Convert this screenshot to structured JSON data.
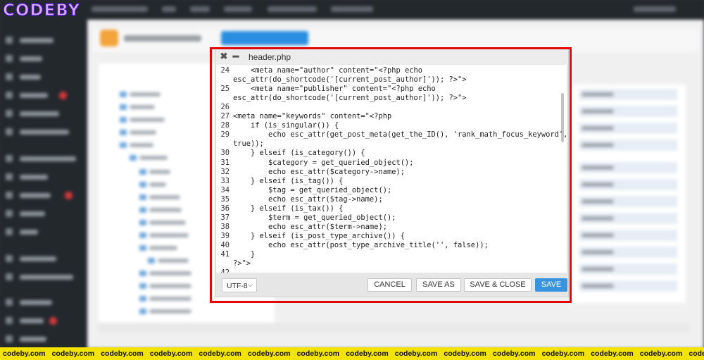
{
  "logo": "CODEBY",
  "dialog": {
    "title": "header.php",
    "close_glyph": "✖",
    "minimize_glyph": "━",
    "code_lines": [
      {
        "n": "24",
        "text": "    <meta name=\"author\" content=\"<?php echo"
      },
      {
        "n": "",
        "text": "esc_attr(do_shortcode('[current_post_author]')); ?>\">"
      },
      {
        "n": "25",
        "text": "    <meta name=\"publisher\" content=\"<?php echo"
      },
      {
        "n": "",
        "text": "esc_attr(do_shortcode('[current_post_author]')); ?>\">"
      },
      {
        "n": "26",
        "text": ""
      },
      {
        "n": "27",
        "text": "<meta name=\"keywords\" content=\"<?php"
      },
      {
        "n": "28",
        "text": "    if (is_singular()) {"
      },
      {
        "n": "29",
        "text": "        echo esc_attr(get_post_meta(get_the_ID(), 'rank_math_focus_keyword',"
      },
      {
        "n": "",
        "text": "true));"
      },
      {
        "n": "30",
        "text": "    } elseif (is_category()) {"
      },
      {
        "n": "31",
        "text": "        $category = get_queried_object();"
      },
      {
        "n": "32",
        "text": "        echo esc_attr($category->name);"
      },
      {
        "n": "33",
        "text": "    } elseif (is_tag()) {"
      },
      {
        "n": "34",
        "text": "        $tag = get_queried_object();"
      },
      {
        "n": "35",
        "text": "        echo esc_attr($tag->name);"
      },
      {
        "n": "36",
        "text": "    } elseif (is_tax()) {"
      },
      {
        "n": "37",
        "text": "        $term = get_queried_object();"
      },
      {
        "n": "38",
        "text": "        echo esc_attr($term->name);"
      },
      {
        "n": "39",
        "text": "    } elseif (is_post_type_archive()) {"
      },
      {
        "n": "40",
        "text": "        echo esc_attr(post_type_archive_title('', false));"
      },
      {
        "n": "41",
        "text": "    }"
      },
      {
        "n": "",
        "text": "?>\">"
      },
      {
        "n": "42",
        "text": ""
      }
    ],
    "encoding": "UTF-8",
    "encoding_chevron": "⌵",
    "buttons": {
      "cancel": "CANCEL",
      "save_as": "SAVE AS",
      "save_close": "SAVE & CLOSE",
      "save": "SAVE"
    }
  },
  "watermark": {
    "text": "codeby.com",
    "repeat": 15
  },
  "colors": {
    "highlight_border": "#e0080a",
    "primary_button": "#3a93de",
    "ticker_bg": "#f3e400",
    "logo_outline": "#3d0fb8"
  }
}
